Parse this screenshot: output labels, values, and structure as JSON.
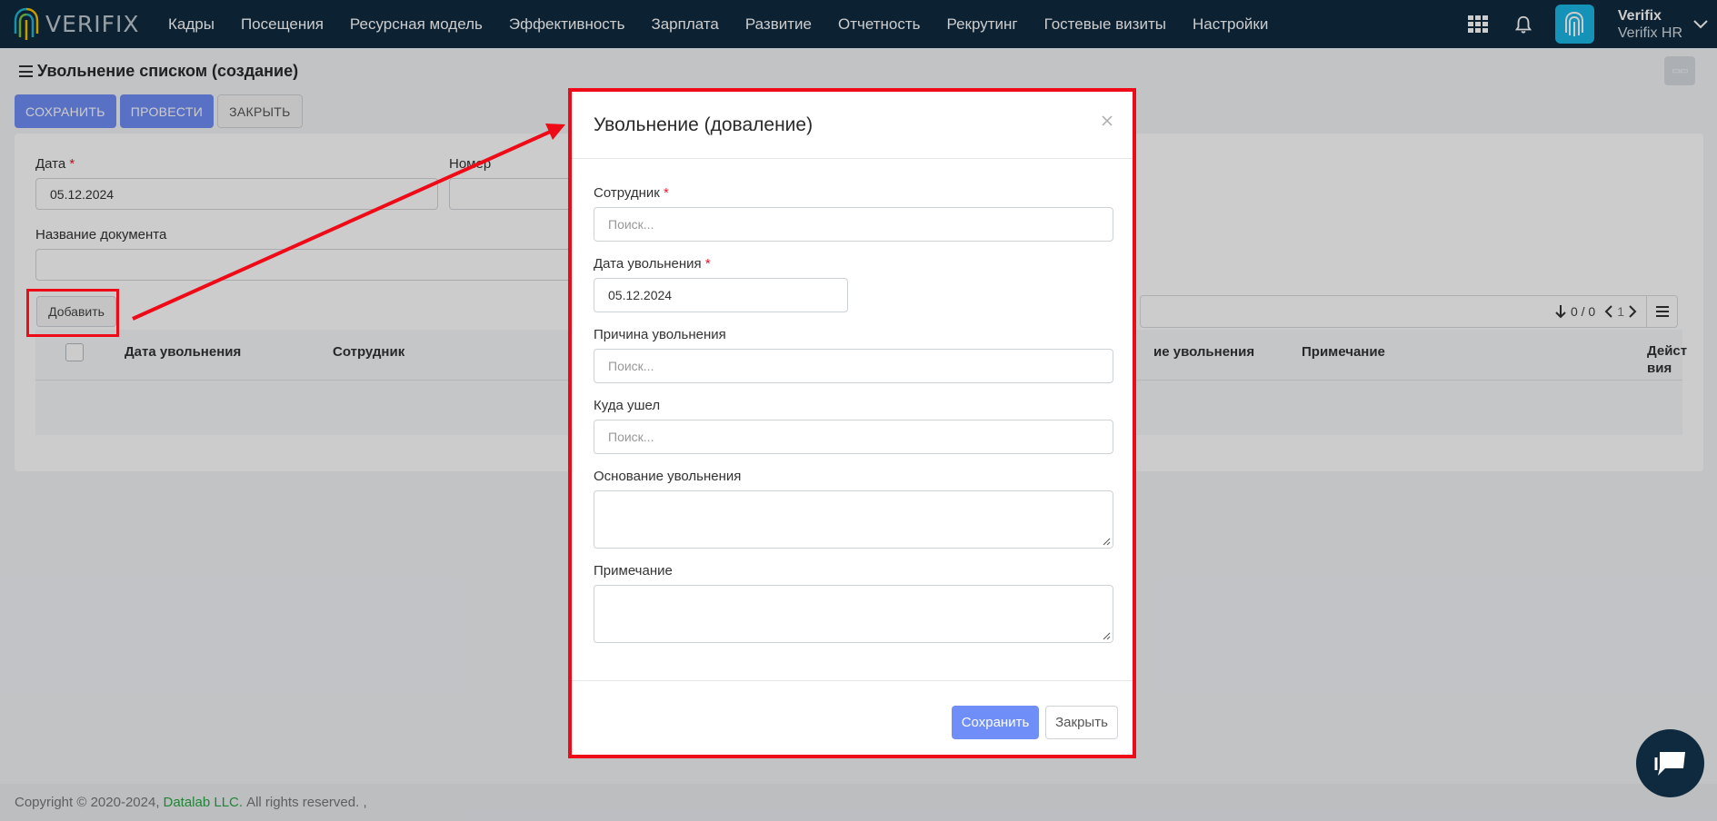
{
  "app": {
    "logo_text": "VERIFIX",
    "menu": [
      "Кадры",
      "Посещения",
      "Ресурсная модель",
      "Эффективность",
      "Зарплата",
      "Развитие",
      "Отчетность",
      "Рекрутинг",
      "Гостевые визиты",
      "Настройки"
    ],
    "user": {
      "name": "Verifix",
      "org": "Verifix HR"
    }
  },
  "page": {
    "title": "Увольнение списком (создание)",
    "toolbar": {
      "save": "СОХРАНИТЬ",
      "post": "ПРОВЕСТИ",
      "close": "ЗАКРЫТЬ"
    },
    "form": {
      "date_label": "Дата",
      "date_value": "05.12.2024",
      "number_label": "Номер",
      "doc_name_label": "Название документа"
    },
    "add_button": "Добавить",
    "pager": {
      "count": "0 / 0",
      "page": "1"
    },
    "table_headers": {
      "dismissal_date": "Дата увольнения",
      "employee": "Сотрудник",
      "basis": "ие увольнения",
      "note": "Примечание",
      "actions_1": "Дейст",
      "actions_2": "вия"
    }
  },
  "modal": {
    "title": "Увольнение (доваление)",
    "employee_label": "Сотрудник",
    "employee_placeholder": "Поиск...",
    "date_label": "Дата увольнения",
    "date_value": "05.12.2024",
    "reason_label": "Причина увольнения",
    "reason_placeholder": "Поиск...",
    "where_label": "Куда ушел",
    "where_placeholder": "Поиск...",
    "basis_label": "Основание увольнения",
    "note_label": "Примечание",
    "save": "Сохранить",
    "close": "Закрыть"
  },
  "footer": {
    "copyright": "Copyright © 2020-2024,",
    "company": "Datalab LLC.",
    "rights": "All rights reserved. ,"
  },
  "colors": {
    "nav_bg": "#0f2a3f",
    "primary": "#6f8ef7",
    "highlight": "#ee0a17",
    "avatar": "#19b7e6"
  }
}
